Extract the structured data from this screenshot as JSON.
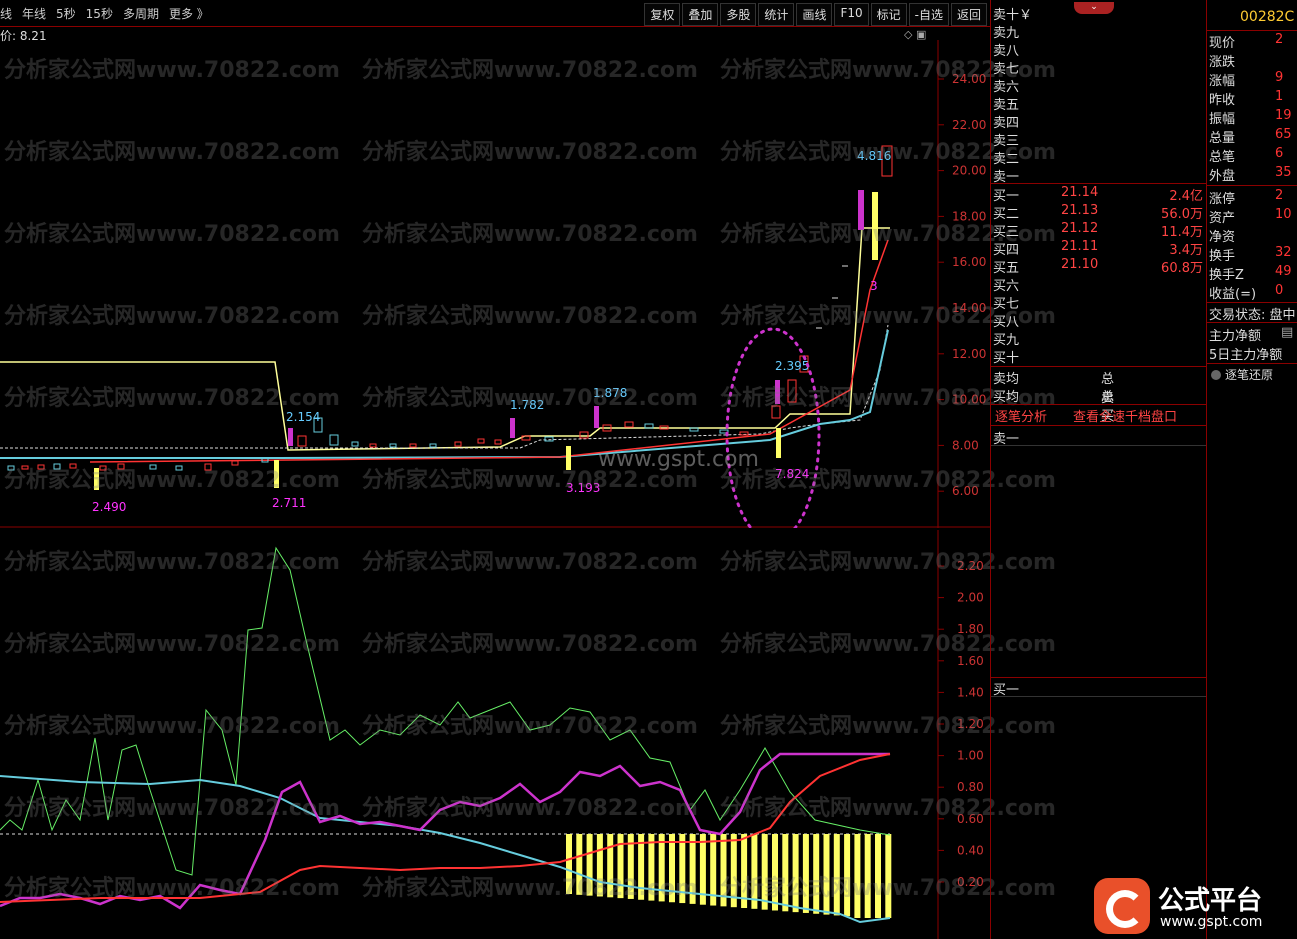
{
  "toolbar": {
    "left_items": [
      "线",
      "年线",
      "5秒",
      "15秒",
      "多周期",
      "更多 》"
    ],
    "right_buttons": [
      "复权",
      "叠加",
      "多股",
      "统计",
      "画线",
      "F10",
      "标记",
      "-自选",
      "返回"
    ]
  },
  "price_label": "价: 8.21",
  "watermark": "分析家公式网www.70822.com",
  "gspt_watermark": "www.gspt.com",
  "main_chart": {
    "y_ticks": [
      "24.00",
      "22.00",
      "20.00",
      "18.00",
      "16.00",
      "14.00",
      "12.00",
      "10.00",
      "8.00",
      "6.00"
    ],
    "annotations": [
      {
        "text": "2.490",
        "color": "#ff33ff"
      },
      {
        "text": "2.711",
        "color": "#ff33ff"
      },
      {
        "text": "2.154",
        "color": "#66ccff"
      },
      {
        "text": "1.782",
        "color": "#66ccff"
      },
      {
        "text": "3.193",
        "color": "#ff33ff"
      },
      {
        "text": "1.878",
        "color": "#66ccff"
      },
      {
        "text": "2.395",
        "color": "#66ccff"
      },
      {
        "text": "7.824",
        "color": "#ff33ff"
      },
      {
        "text": "4.816",
        "color": "#66ccff"
      },
      {
        "text": "3",
        "color": "#ff33ff"
      }
    ]
  },
  "ind_chart": {
    "y_ticks": [
      "2.20",
      "2.00",
      "1.80",
      "1.60",
      "1.40",
      "1.20",
      "1.00",
      "0.80",
      "0.60",
      "0.40",
      "0.20"
    ]
  },
  "orderbook": {
    "sell": [
      "卖十￥",
      "卖九",
      "卖八",
      "卖七",
      "卖六",
      "卖五",
      "卖四",
      "卖三",
      "卖二",
      "卖一"
    ],
    "buy": [
      {
        "name": "买一",
        "price": "21.14",
        "vol": "2.4亿"
      },
      {
        "name": "买二",
        "price": "21.13",
        "vol": "56.0万"
      },
      {
        "name": "买三",
        "price": "21.12",
        "vol": "11.4万"
      },
      {
        "name": "买四",
        "price": "21.11",
        "vol": "3.4万"
      },
      {
        "name": "买五",
        "price": "21.10",
        "vol": "60.8万"
      },
      {
        "name": "买六",
        "price": "",
        "vol": ""
      },
      {
        "name": "买七",
        "price": "",
        "vol": ""
      },
      {
        "name": "买八",
        "price": "",
        "vol": ""
      },
      {
        "name": "买九",
        "price": "",
        "vol": ""
      },
      {
        "name": "买十",
        "price": "",
        "vol": ""
      }
    ],
    "sell_avg": "卖均",
    "total_sell": "总卖",
    "buy_avg": "买均",
    "total_buy": "总买",
    "tick_analysis": "逐笔分析",
    "full_depth": "查看全速千档盘口",
    "sell_one_detail": "卖一",
    "buy_one_detail": "买一"
  },
  "quote": {
    "code": "00282C",
    "rows": [
      {
        "label": "现价",
        "value": "2"
      },
      {
        "label": "涨跌",
        "value": ""
      },
      {
        "label": "涨幅",
        "value": "9"
      },
      {
        "label": "昨收",
        "value": "1"
      },
      {
        "label": "振幅",
        "value": "19"
      },
      {
        "label": "总量",
        "value": "65"
      },
      {
        "label": "总笔",
        "value": "6"
      },
      {
        "label": "外盘",
        "value": "35"
      },
      {
        "label": "涨停",
        "value": "2"
      },
      {
        "label": "资产",
        "value": "10"
      },
      {
        "label": "净资",
        "value": ""
      },
      {
        "label": "换手",
        "value": "32"
      },
      {
        "label": "换手Z",
        "value": "49"
      },
      {
        "label": "收益(=)",
        "value": "0"
      }
    ],
    "trade_status": "交易状态: 盘中",
    "main_net": "主力净额",
    "main_net_5d": "5日主力净额",
    "tick_restore": "逐笔还原"
  },
  "logo": {
    "title": "公式平台",
    "url": "www.gspt.com"
  },
  "colors": {
    "up": "#ff3333",
    "frame": "#8b0000",
    "yellow": "#ffff66",
    "magenta": "#cc33cc",
    "cyan": "#66ccdd",
    "green": "#66ee66"
  }
}
